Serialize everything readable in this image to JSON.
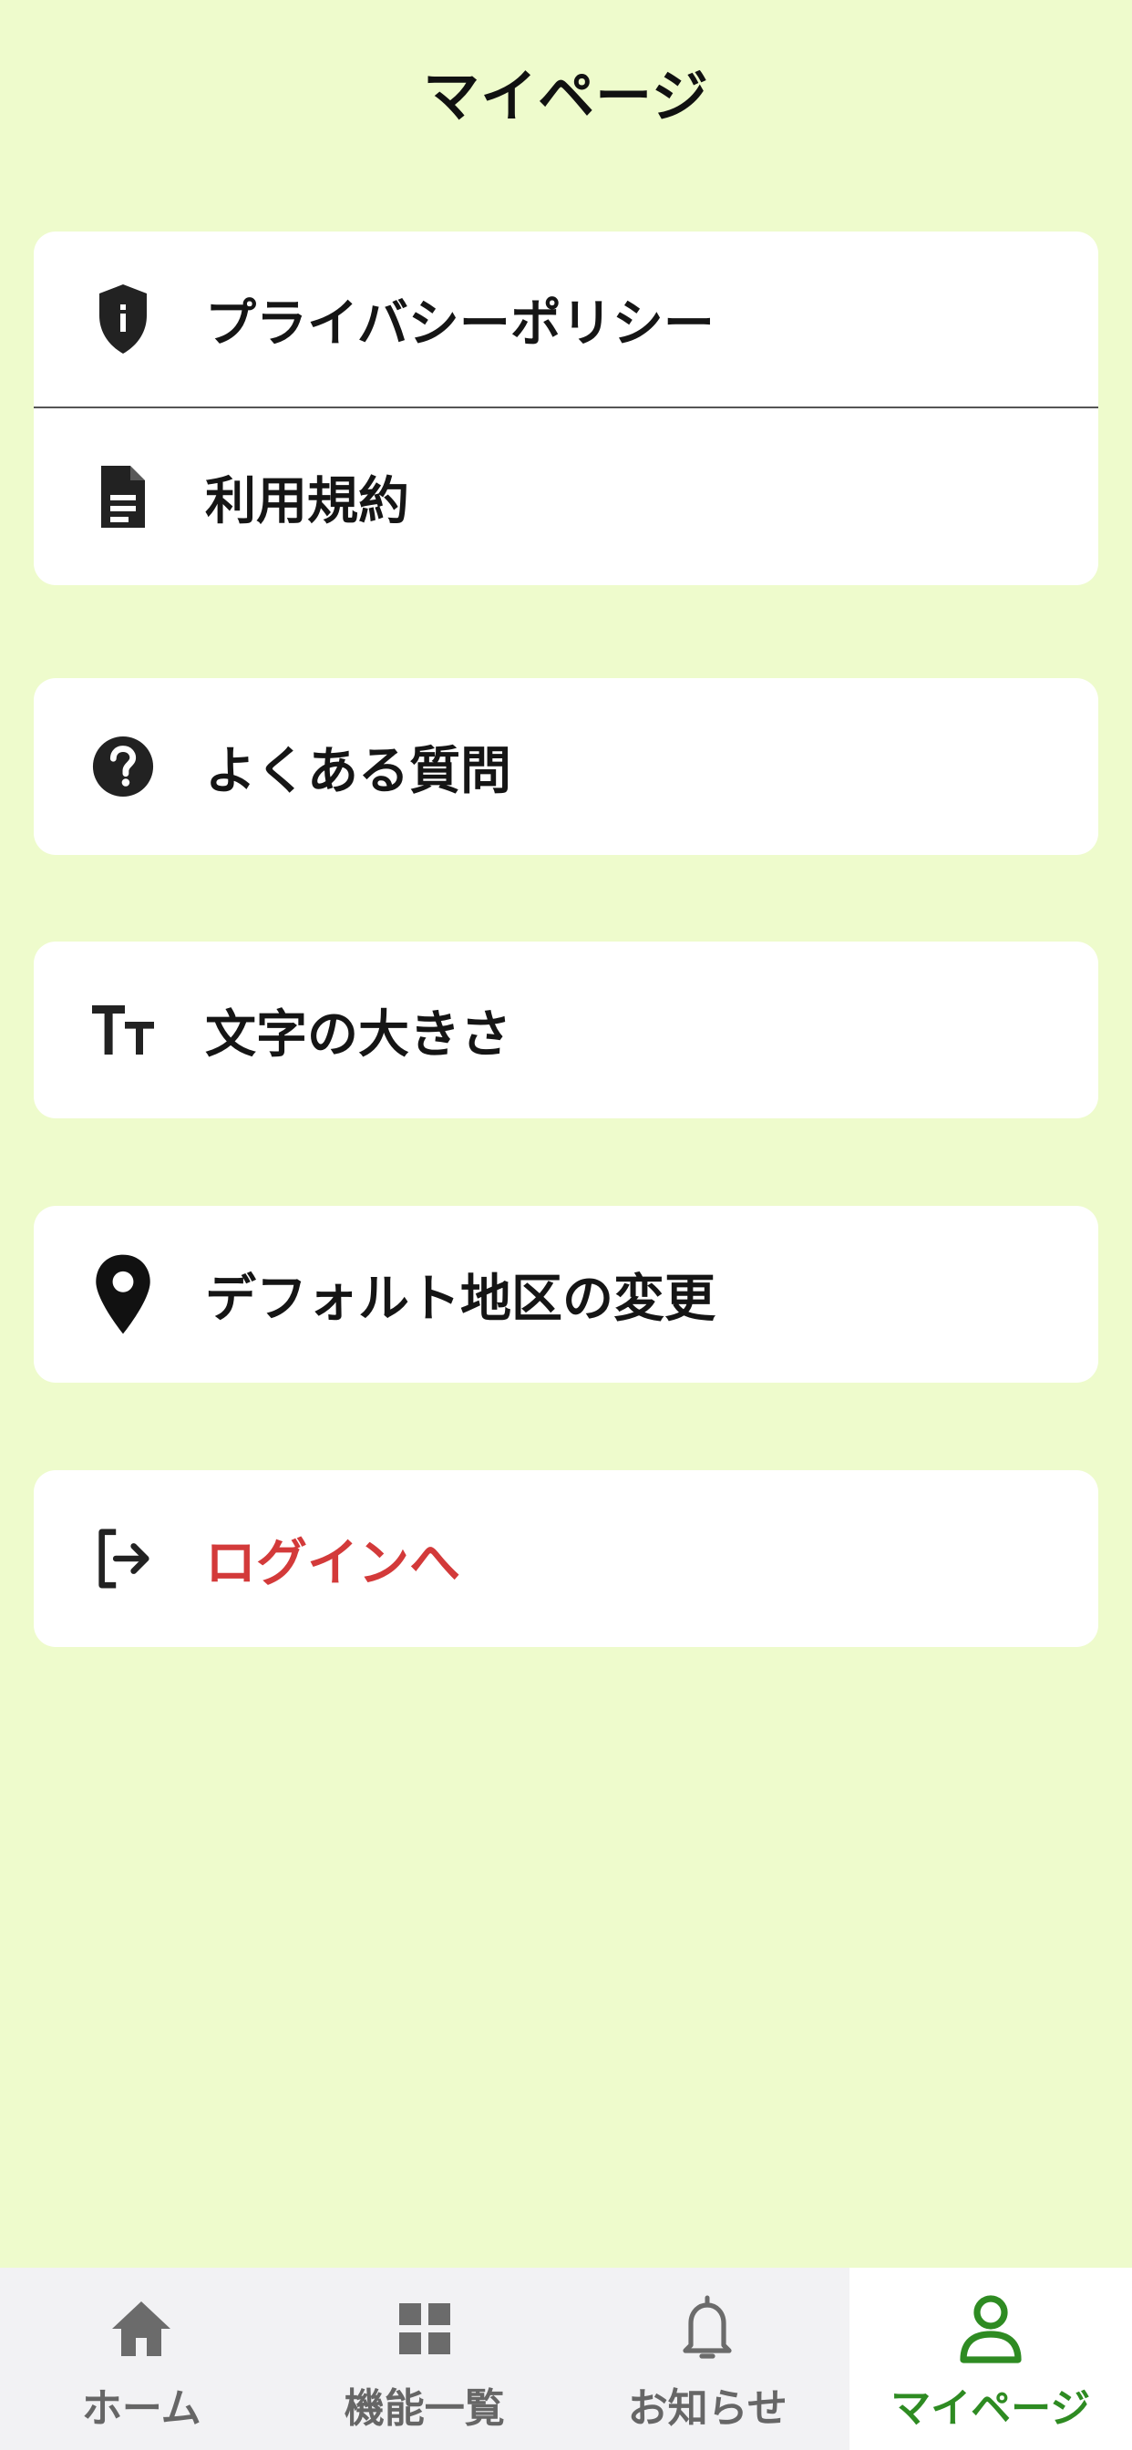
{
  "header": {
    "title": "マイページ"
  },
  "menu": {
    "privacy_policy": {
      "label": "プライバシーポリシー",
      "icon": "shield-icon"
    },
    "terms": {
      "label": "利用規約",
      "icon": "document-icon"
    },
    "faq": {
      "label": "よくある質問",
      "icon": "question-circle-icon"
    },
    "font_size": {
      "label": "文字の大きさ",
      "icon": "text-size-icon"
    },
    "default_area": {
      "label": "デフォルト地区の変更",
      "icon": "map-pin-icon"
    },
    "login": {
      "label": "ログインへ",
      "icon": "login-icon"
    }
  },
  "tabbar": {
    "tabs": [
      {
        "label": "ホーム",
        "icon": "home-icon",
        "active": false
      },
      {
        "label": "機能一覧",
        "icon": "grid-icon",
        "active": false
      },
      {
        "label": "お知らせ",
        "icon": "bell-icon",
        "active": false
      },
      {
        "label": "マイページ",
        "icon": "user-icon",
        "active": true
      }
    ]
  },
  "colors": {
    "background": "#eefbcc",
    "card": "#ffffff",
    "danger": "#d33a3a",
    "active_tab": "#2e8b22",
    "tabbar_bg": "#f2f2f4"
  }
}
